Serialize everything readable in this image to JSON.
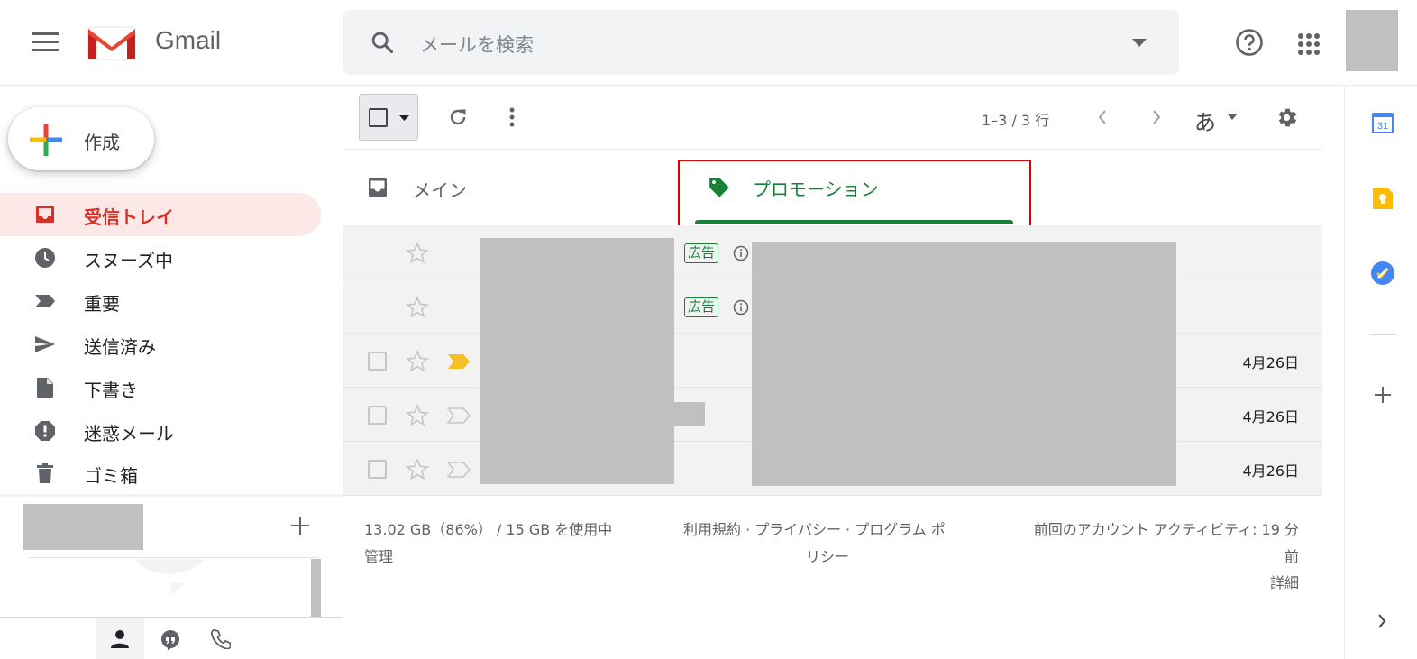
{
  "app": {
    "name": "Gmail"
  },
  "search": {
    "placeholder": "メールを検索"
  },
  "compose": {
    "label": "作成"
  },
  "sidebar": {
    "items": [
      {
        "label": "受信トレイ",
        "icon": "inbox-icon",
        "active": true
      },
      {
        "label": "スヌーズ中",
        "icon": "clock-icon",
        "active": false
      },
      {
        "label": "重要",
        "icon": "label-important-icon",
        "active": false
      },
      {
        "label": "送信済み",
        "icon": "send-icon",
        "active": false
      },
      {
        "label": "下書き",
        "icon": "draft-icon",
        "active": false
      },
      {
        "label": "迷惑メール",
        "icon": "spam-icon",
        "active": false
      },
      {
        "label": "ゴミ箱",
        "icon": "trash-icon",
        "active": false
      }
    ]
  },
  "toolbar": {
    "pagination": "1–3 / 3 行",
    "input_mode": "あ"
  },
  "tabs": [
    {
      "label": "メイン",
      "icon": "inbox-tab-icon",
      "selected": false
    },
    {
      "label": "プロモーション",
      "icon": "tag-icon",
      "selected": true
    }
  ],
  "emails": [
    {
      "ad_badge": "広告",
      "date": "",
      "important": false
    },
    {
      "ad_badge": "広告",
      "date": "",
      "important": false
    },
    {
      "ad_badge": "",
      "date": "4月26日",
      "important": true
    },
    {
      "ad_badge": "",
      "date": "4月26日",
      "important": false
    },
    {
      "ad_badge": "",
      "date": "4月26日",
      "important": false
    }
  ],
  "footer": {
    "storage": "13.02 GB（86%） / 15 GB を使用中",
    "manage": "管理",
    "links_line1": "利用規約 · プライバシー · プログラム ポ",
    "links_line2": "リシー",
    "activity_line1": "前回のアカウント アクティビティ: 19 分",
    "activity_line2": "前",
    "details": "詳細"
  },
  "colors": {
    "accent_red": "#d93025",
    "promo_green": "#188038",
    "highlight_box": "#e00000",
    "important_yellow": "#f6bf26"
  }
}
